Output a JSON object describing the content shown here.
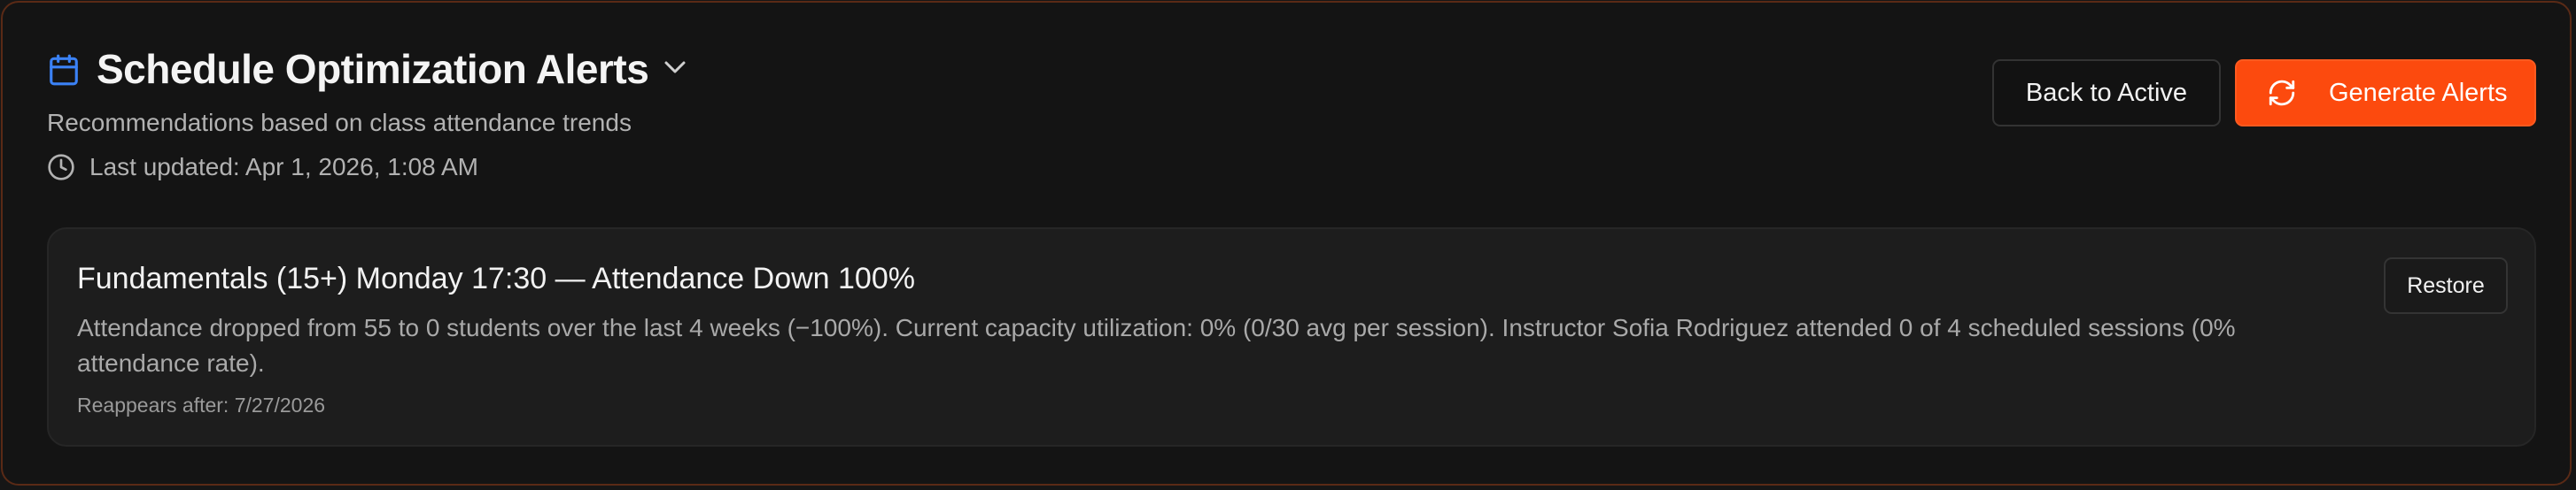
{
  "header": {
    "title": "Schedule Optimization Alerts",
    "subtitle": "Recommendations based on class attendance trends",
    "last_updated": "Last updated: Apr 1, 2026, 1:08 AM",
    "icons": {
      "title": "calendar-icon",
      "dropdown": "chevron-down-icon",
      "updated": "clock-icon"
    }
  },
  "actions": {
    "back_label": "Back to Active",
    "generate_label": "Generate Alerts",
    "generate_icon": "refresh-icon"
  },
  "alert": {
    "title": "Fundamentals (15+) Monday 17:30 — Attendance Down 100%",
    "description": "Attendance dropped from 55 to 0 students over the last 4 weeks (−100%). Current capacity utilization: 0% (0/30 avg per session). Instructor Sofia Rodriguez attended 0 of 4 scheduled sessions (0% attendance rate).",
    "reappears": "Reappears after: 7/27/2026",
    "restore_label": "Restore"
  },
  "colors": {
    "accent": "#fc4a0e",
    "calendar_icon": "#3b82f6",
    "background": "#141414",
    "border": "#5a2a16"
  }
}
